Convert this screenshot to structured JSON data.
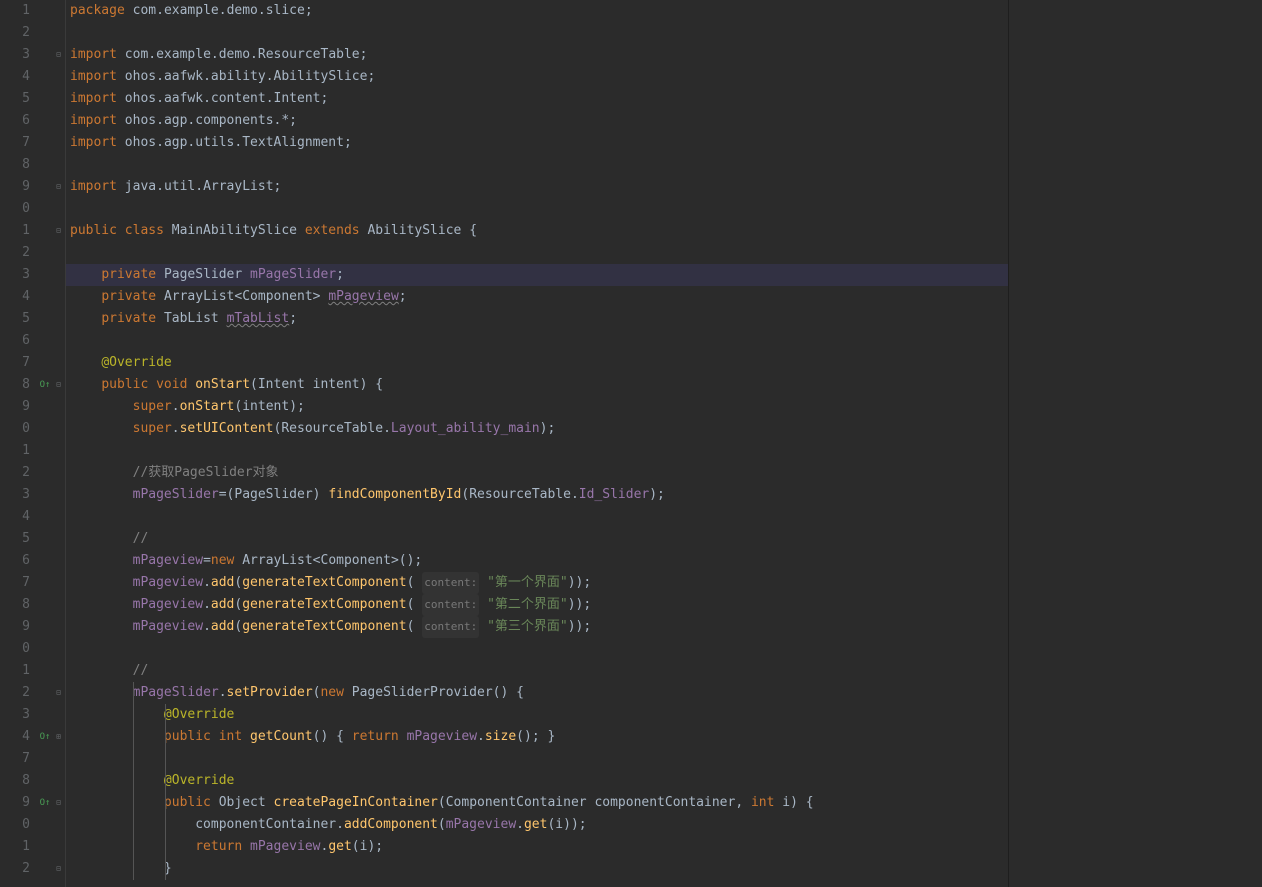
{
  "lines": [
    {
      "n": "1",
      "fold": "",
      "icon": "",
      "tokens": [
        [
          "kw",
          "package "
        ],
        [
          "cls",
          "com"
        ],
        [
          "parn",
          "."
        ],
        [
          "cls",
          "example"
        ],
        [
          "parn",
          "."
        ],
        [
          "cls",
          "demo"
        ],
        [
          "parn",
          "."
        ],
        [
          "cls",
          "slice"
        ],
        [
          "parn",
          ";"
        ]
      ]
    },
    {
      "n": "2",
      "fold": "",
      "icon": "",
      "tokens": []
    },
    {
      "n": "3",
      "fold": "⊟",
      "icon": "",
      "tokens": [
        [
          "kw",
          "import "
        ],
        [
          "cls",
          "com"
        ],
        [
          "parn",
          "."
        ],
        [
          "cls",
          "example"
        ],
        [
          "parn",
          "."
        ],
        [
          "cls",
          "demo"
        ],
        [
          "parn",
          "."
        ],
        [
          "cls",
          "ResourceTable"
        ],
        [
          "parn",
          ";"
        ]
      ]
    },
    {
      "n": "4",
      "fold": "",
      "icon": "",
      "tokens": [
        [
          "kw",
          "import "
        ],
        [
          "cls",
          "ohos"
        ],
        [
          "parn",
          "."
        ],
        [
          "cls",
          "aafwk"
        ],
        [
          "parn",
          "."
        ],
        [
          "cls",
          "ability"
        ],
        [
          "parn",
          "."
        ],
        [
          "cls",
          "AbilitySlice"
        ],
        [
          "parn",
          ";"
        ]
      ]
    },
    {
      "n": "5",
      "fold": "",
      "icon": "",
      "tokens": [
        [
          "kw",
          "import "
        ],
        [
          "cls",
          "ohos"
        ],
        [
          "parn",
          "."
        ],
        [
          "cls",
          "aafwk"
        ],
        [
          "parn",
          "."
        ],
        [
          "cls",
          "content"
        ],
        [
          "parn",
          "."
        ],
        [
          "cls",
          "Intent"
        ],
        [
          "parn",
          ";"
        ]
      ]
    },
    {
      "n": "6",
      "fold": "",
      "icon": "",
      "tokens": [
        [
          "kw",
          "import "
        ],
        [
          "cls",
          "ohos"
        ],
        [
          "parn",
          "."
        ],
        [
          "cls",
          "agp"
        ],
        [
          "parn",
          "."
        ],
        [
          "cls",
          "components"
        ],
        [
          "parn",
          ".*;"
        ]
      ]
    },
    {
      "n": "7",
      "fold": "",
      "icon": "",
      "tokens": [
        [
          "kw",
          "import "
        ],
        [
          "cls",
          "ohos"
        ],
        [
          "parn",
          "."
        ],
        [
          "cls",
          "agp"
        ],
        [
          "parn",
          "."
        ],
        [
          "cls",
          "utils"
        ],
        [
          "parn",
          "."
        ],
        [
          "cls",
          "TextAlignment"
        ],
        [
          "parn",
          ";"
        ]
      ]
    },
    {
      "n": "8",
      "fold": "",
      "icon": "",
      "tokens": []
    },
    {
      "n": "9",
      "fold": "⊟",
      "icon": "",
      "tokens": [
        [
          "kw",
          "import "
        ],
        [
          "cls",
          "java"
        ],
        [
          "parn",
          "."
        ],
        [
          "cls",
          "util"
        ],
        [
          "parn",
          "."
        ],
        [
          "cls",
          "ArrayList"
        ],
        [
          "parn",
          ";"
        ]
      ]
    },
    {
      "n": "0",
      "fold": "",
      "icon": "",
      "tokens": []
    },
    {
      "n": "1",
      "fold": "⊟",
      "icon": "",
      "tokens": [
        [
          "kw",
          "public class "
        ],
        [
          "cls",
          "MainAbilitySlice "
        ],
        [
          "kw",
          "extends "
        ],
        [
          "cls",
          "AbilitySlice "
        ],
        [
          "parn",
          "{"
        ]
      ]
    },
    {
      "n": "2",
      "fold": "",
      "icon": "",
      "tokens": []
    },
    {
      "n": "3",
      "fold": "",
      "icon": "",
      "hl": true,
      "tokens": [
        [
          "parn",
          "    "
        ],
        [
          "kw",
          "private "
        ],
        [
          "cls",
          "PageSlider "
        ],
        [
          "fld",
          "mPageSlider"
        ],
        [
          "parn",
          ";"
        ]
      ]
    },
    {
      "n": "4",
      "fold": "",
      "icon": "",
      "tokens": [
        [
          "parn",
          "    "
        ],
        [
          "kw",
          "private "
        ],
        [
          "cls",
          "ArrayList"
        ],
        [
          "parn",
          "<"
        ],
        [
          "cls",
          "Component"
        ],
        [
          "parn",
          "> "
        ],
        [
          "fld warn",
          "mPageview"
        ],
        [
          "parn",
          ";"
        ]
      ]
    },
    {
      "n": "5",
      "fold": "",
      "icon": "",
      "tokens": [
        [
          "parn",
          "    "
        ],
        [
          "kw",
          "private "
        ],
        [
          "cls",
          "TabList "
        ],
        [
          "fld warn",
          "mTabList"
        ],
        [
          "parn",
          ";"
        ]
      ]
    },
    {
      "n": "6",
      "fold": "",
      "icon": "",
      "tokens": []
    },
    {
      "n": "7",
      "fold": "",
      "icon": "",
      "tokens": [
        [
          "parn",
          "    "
        ],
        [
          "ann",
          "@Override"
        ]
      ]
    },
    {
      "n": "8",
      "fold": "⊟",
      "icon": "ov",
      "tokens": [
        [
          "parn",
          "    "
        ],
        [
          "kw",
          "public void "
        ],
        [
          "mth",
          "onStart"
        ],
        [
          "parn",
          "("
        ],
        [
          "cls",
          "Intent "
        ],
        [
          "param",
          "intent"
        ],
        [
          "parn",
          ") {"
        ]
      ]
    },
    {
      "n": "9",
      "fold": "",
      "icon": "",
      "tokens": [
        [
          "parn",
          "        "
        ],
        [
          "kw",
          "super"
        ],
        [
          "parn",
          "."
        ],
        [
          "mth",
          "onStart"
        ],
        [
          "parn",
          "("
        ],
        [
          "param",
          "intent"
        ],
        [
          "parn",
          ");"
        ]
      ]
    },
    {
      "n": "0",
      "fold": "",
      "icon": "",
      "tokens": [
        [
          "parn",
          "        "
        ],
        [
          "kw",
          "super"
        ],
        [
          "parn",
          "."
        ],
        [
          "mth",
          "setUIContent"
        ],
        [
          "parn",
          "("
        ],
        [
          "cls",
          "ResourceTable"
        ],
        [
          "parn",
          "."
        ],
        [
          "fld",
          "Layout_ability_main"
        ],
        [
          "parn",
          ");"
        ]
      ]
    },
    {
      "n": "1",
      "fold": "",
      "icon": "",
      "tokens": []
    },
    {
      "n": "2",
      "fold": "",
      "icon": "",
      "tokens": [
        [
          "parn",
          "        "
        ],
        [
          "cmt",
          "//获取PageSlider对象"
        ]
      ]
    },
    {
      "n": "3",
      "fold": "",
      "icon": "",
      "tokens": [
        [
          "parn",
          "        "
        ],
        [
          "fld",
          "mPageSlider"
        ],
        [
          "parn",
          "=("
        ],
        [
          "cls",
          "PageSlider"
        ],
        [
          "parn",
          ") "
        ],
        [
          "mth",
          "findComponentById"
        ],
        [
          "parn",
          "("
        ],
        [
          "cls",
          "ResourceTable"
        ],
        [
          "parn",
          "."
        ],
        [
          "fld",
          "Id_Slider"
        ],
        [
          "parn",
          ");"
        ]
      ]
    },
    {
      "n": "4",
      "fold": "",
      "icon": "",
      "tokens": []
    },
    {
      "n": "5",
      "fold": "",
      "icon": "",
      "tokens": [
        [
          "parn",
          "        "
        ],
        [
          "cmt",
          "//"
        ]
      ]
    },
    {
      "n": "6",
      "fold": "",
      "icon": "",
      "tokens": [
        [
          "parn",
          "        "
        ],
        [
          "fld",
          "mPageview"
        ],
        [
          "parn",
          "="
        ],
        [
          "kw",
          "new "
        ],
        [
          "cls",
          "ArrayList"
        ],
        [
          "parn",
          "<"
        ],
        [
          "cls",
          "Component"
        ],
        [
          "parn",
          ">();"
        ]
      ]
    },
    {
      "n": "7",
      "fold": "",
      "icon": "",
      "tokens": [
        [
          "parn",
          "        "
        ],
        [
          "fld",
          "mPageview"
        ],
        [
          "parn",
          "."
        ],
        [
          "mth",
          "add"
        ],
        [
          "parn",
          "("
        ],
        [
          "mth",
          "generateTextComponent"
        ],
        [
          "parn",
          "( "
        ],
        [
          "hint",
          "content:"
        ],
        [
          "parn",
          " "
        ],
        [
          "str",
          "\"第一个界面\""
        ],
        [
          "parn",
          "));"
        ]
      ]
    },
    {
      "n": "8",
      "fold": "",
      "icon": "",
      "tokens": [
        [
          "parn",
          "        "
        ],
        [
          "fld",
          "mPageview"
        ],
        [
          "parn",
          "."
        ],
        [
          "mth",
          "add"
        ],
        [
          "parn",
          "("
        ],
        [
          "mth",
          "generateTextComponent"
        ],
        [
          "parn",
          "( "
        ],
        [
          "hint",
          "content:"
        ],
        [
          "parn",
          " "
        ],
        [
          "str",
          "\"第二个界面\""
        ],
        [
          "parn",
          "));"
        ]
      ]
    },
    {
      "n": "9",
      "fold": "",
      "icon": "",
      "tokens": [
        [
          "parn",
          "        "
        ],
        [
          "fld",
          "mPageview"
        ],
        [
          "parn",
          "."
        ],
        [
          "mth",
          "add"
        ],
        [
          "parn",
          "("
        ],
        [
          "mth",
          "generateTextComponent"
        ],
        [
          "parn",
          "( "
        ],
        [
          "hint",
          "content:"
        ],
        [
          "parn",
          " "
        ],
        [
          "str",
          "\"第三个界面\""
        ],
        [
          "parn",
          "));"
        ]
      ]
    },
    {
      "n": "0",
      "fold": "",
      "icon": "",
      "tokens": []
    },
    {
      "n": "1",
      "fold": "",
      "icon": "",
      "tokens": [
        [
          "parn",
          "        "
        ],
        [
          "cmt",
          "//"
        ]
      ]
    },
    {
      "n": "2",
      "fold": "⊟",
      "icon": "",
      "tokens": [
        [
          "parn",
          "        "
        ],
        [
          "fld",
          "mPageSlider"
        ],
        [
          "parn",
          "."
        ],
        [
          "mth",
          "setProvider"
        ],
        [
          "parn",
          "("
        ],
        [
          "kw",
          "new "
        ],
        [
          "cls",
          "PageSliderProvider"
        ],
        [
          "parn",
          "() {"
        ]
      ]
    },
    {
      "n": "3",
      "fold": "",
      "icon": "",
      "tokens": [
        [
          "parn",
          "            "
        ],
        [
          "ann",
          "@Override"
        ]
      ]
    },
    {
      "n": "4",
      "fold": "⊞",
      "icon": "ov",
      "tokens": [
        [
          "parn",
          "            "
        ],
        [
          "kw",
          "public int "
        ],
        [
          "mth",
          "getCount"
        ],
        [
          "parn",
          "() { "
        ],
        [
          "kw",
          "return "
        ],
        [
          "fld",
          "mPageview"
        ],
        [
          "parn",
          "."
        ],
        [
          "mth",
          "size"
        ],
        [
          "parn",
          "(); }"
        ]
      ]
    },
    {
      "n": "7",
      "fold": "",
      "icon": "",
      "tokens": []
    },
    {
      "n": "8",
      "fold": "",
      "icon": "",
      "tokens": [
        [
          "parn",
          "            "
        ],
        [
          "ann",
          "@Override"
        ]
      ]
    },
    {
      "n": "9",
      "fold": "⊟",
      "icon": "ov",
      "tokens": [
        [
          "parn",
          "            "
        ],
        [
          "kw",
          "public "
        ],
        [
          "cls",
          "Object "
        ],
        [
          "mth",
          "createPageInContainer"
        ],
        [
          "parn",
          "("
        ],
        [
          "cls",
          "ComponentContainer "
        ],
        [
          "param",
          "componentContainer"
        ],
        [
          "parn",
          ", "
        ],
        [
          "kw",
          "int "
        ],
        [
          "param",
          "i"
        ],
        [
          "parn",
          ") {"
        ]
      ]
    },
    {
      "n": "0",
      "fold": "",
      "icon": "",
      "tokens": [
        [
          "parn",
          "                "
        ],
        [
          "param",
          "componentContainer"
        ],
        [
          "parn",
          "."
        ],
        [
          "mth",
          "addComponent"
        ],
        [
          "parn",
          "("
        ],
        [
          "fld",
          "mPageview"
        ],
        [
          "parn",
          "."
        ],
        [
          "mth",
          "get"
        ],
        [
          "parn",
          "("
        ],
        [
          "param",
          "i"
        ],
        [
          "parn",
          "));"
        ]
      ]
    },
    {
      "n": "1",
      "fold": "",
      "icon": "",
      "tokens": [
        [
          "parn",
          "                "
        ],
        [
          "kw",
          "return "
        ],
        [
          "fld",
          "mPageview"
        ],
        [
          "parn",
          "."
        ],
        [
          "mth",
          "get"
        ],
        [
          "parn",
          "("
        ],
        [
          "param",
          "i"
        ],
        [
          "parn",
          ");"
        ]
      ]
    },
    {
      "n": "2",
      "fold": "⊟",
      "icon": "",
      "tokens": [
        [
          "parn",
          "            }"
        ]
      ]
    }
  ]
}
